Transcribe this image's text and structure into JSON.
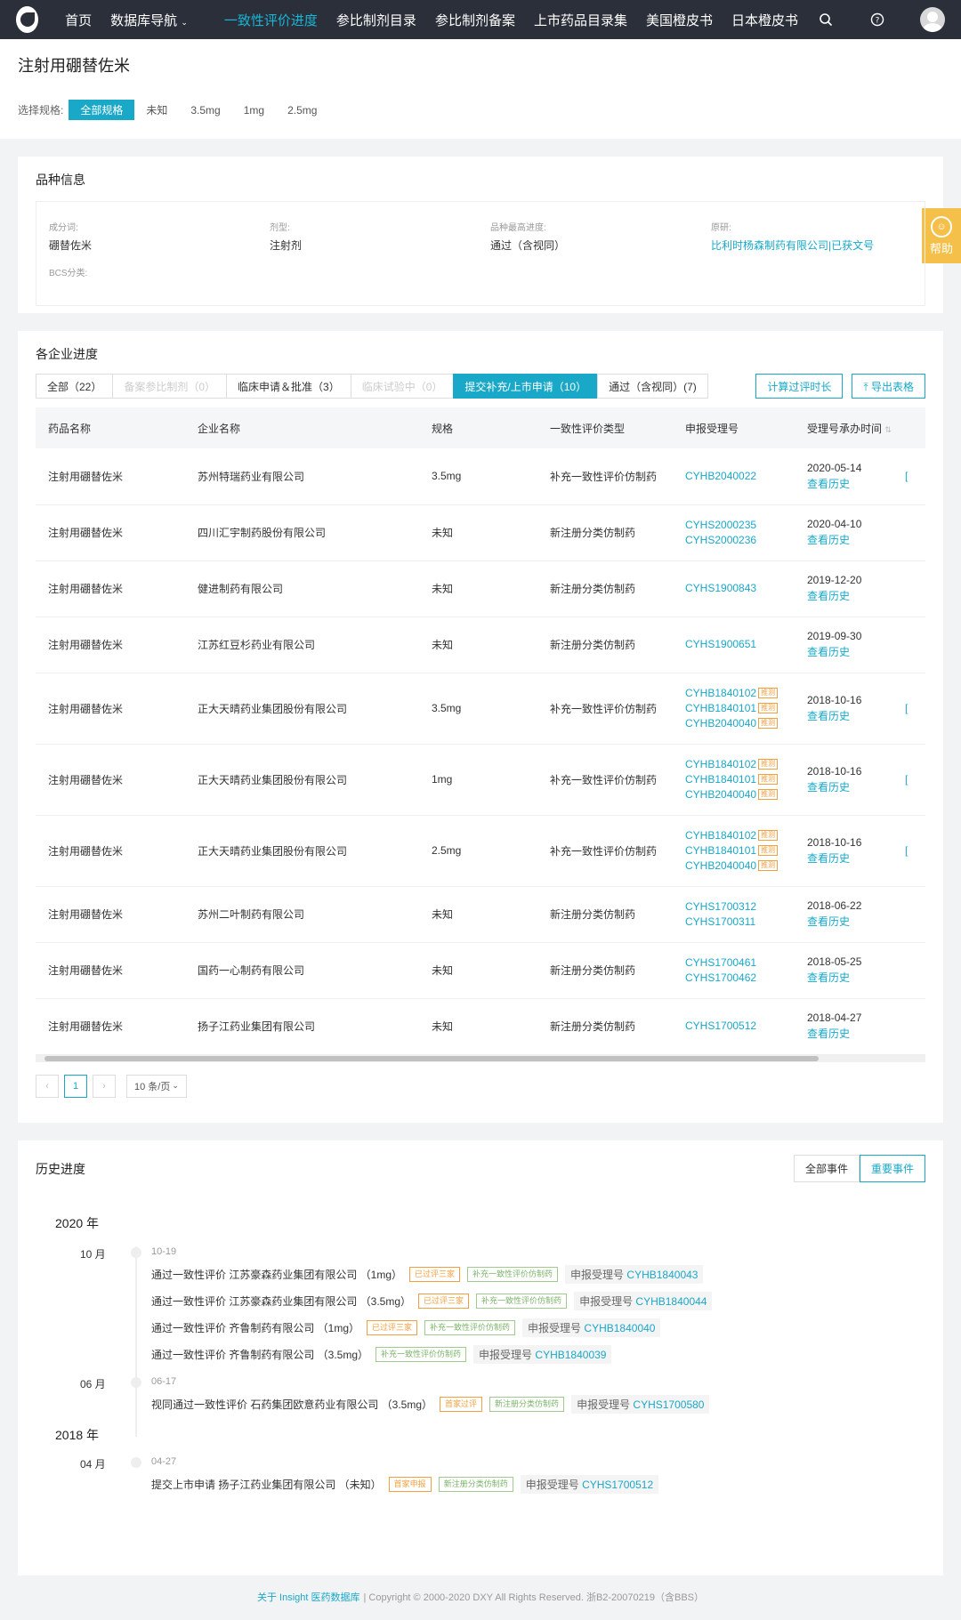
{
  "nav": {
    "items": [
      "首页",
      "数据库导航",
      "一致性评价进度",
      "参比制剂目录",
      "参比制剂备案",
      "上市药品目录集",
      "美国橙皮书",
      "日本橙皮书"
    ]
  },
  "page": {
    "title": "注射用硼替佐米",
    "spec_label": "选择规格:",
    "specs": [
      "全部规格",
      "未知",
      "3.5mg",
      "1mg",
      "2.5mg"
    ]
  },
  "info": {
    "title": "品种信息",
    "ingredient_label": "成分词:",
    "ingredient": "硼替佐米",
    "form_label": "剂型:",
    "form": "注射剂",
    "progress_label": "品种最高进度:",
    "progress": "通过（含视同）",
    "origin_label": "原研:",
    "origin": "比利时杨森制药有限公司|已获文号",
    "bcs_label": "BCS分类:"
  },
  "help": "帮助",
  "enterprise": {
    "title": "各企业进度",
    "tabs": [
      "全部（22）",
      "备案参比制剂（0）",
      "临床申请＆批准（3）",
      "临床试验中（0）",
      "提交补充/上市申请（10）",
      "通过（含视同）(7)"
    ],
    "calc_btn": "计算过评时长",
    "export_btn": "导出表格",
    "columns": [
      "药品名称",
      "企业名称",
      "规格",
      "一致性评价类型",
      "申报受理号",
      "受理号承办时间"
    ],
    "history_link": "查看历史",
    "tui": "推测",
    "rows": [
      {
        "name": "注射用硼替佐米",
        "company": "苏州特瑞药业有限公司",
        "spec": "3.5mg",
        "type": "补充一致性评价仿制药",
        "numbers": [
          "CYHB2040022"
        ],
        "date": "2020-05-14"
      },
      {
        "name": "注射用硼替佐米",
        "company": "四川汇宇制药股份有限公司",
        "spec": "未知",
        "type": "新注册分类仿制药",
        "numbers": [
          "CYHS2000235",
          "CYHS2000236"
        ],
        "date": "2020-04-10"
      },
      {
        "name": "注射用硼替佐米",
        "company": "健进制药有限公司",
        "spec": "未知",
        "type": "新注册分类仿制药",
        "numbers": [
          "CYHS1900843"
        ],
        "date": "2019-12-20"
      },
      {
        "name": "注射用硼替佐米",
        "company": "江苏红豆杉药业有限公司",
        "spec": "未知",
        "type": "新注册分类仿制药",
        "numbers": [
          "CYHS1900651"
        ],
        "date": "2019-09-30"
      },
      {
        "name": "注射用硼替佐米",
        "company": "正大天晴药业集团股份有限公司",
        "spec": "3.5mg",
        "type": "补充一致性评价仿制药",
        "numbers": [
          "CYHB1840102",
          "CYHB1840101",
          "CYHB2040040"
        ],
        "date": "2018-10-16"
      },
      {
        "name": "注射用硼替佐米",
        "company": "正大天晴药业集团股份有限公司",
        "spec": "1mg",
        "type": "补充一致性评价仿制药",
        "numbers": [
          "CYHB1840102",
          "CYHB1840101",
          "CYHB2040040"
        ],
        "date": "2018-10-16"
      },
      {
        "name": "注射用硼替佐米",
        "company": "正大天晴药业集团股份有限公司",
        "spec": "2.5mg",
        "type": "补充一致性评价仿制药",
        "numbers": [
          "CYHB1840102",
          "CYHB1840101",
          "CYHB2040040"
        ],
        "date": "2018-10-16"
      },
      {
        "name": "注射用硼替佐米",
        "company": "苏州二叶制药有限公司",
        "spec": "未知",
        "type": "新注册分类仿制药",
        "numbers": [
          "CYHS1700312",
          "CYHS1700311"
        ],
        "date": "2018-06-22"
      },
      {
        "name": "注射用硼替佐米",
        "company": "国药一心制药有限公司",
        "spec": "未知",
        "type": "新注册分类仿制药",
        "numbers": [
          "CYHS1700461",
          "CYHS1700462"
        ],
        "date": "2018-05-25"
      },
      {
        "name": "注射用硼替佐米",
        "company": "扬子江药业集团有限公司",
        "spec": "未知",
        "type": "新注册分类仿制药",
        "numbers": [
          "CYHS1700512"
        ],
        "date": "2018-04-27"
      }
    ],
    "page_current": "1",
    "page_size": "10 条/页"
  },
  "history": {
    "title": "历史进度",
    "seg_all": "全部事件",
    "seg_major": "重要事件",
    "ref_label": "申报受理号",
    "year1": "2020 年",
    "m1": "10 月",
    "d1": "10-19",
    "m2": "06 月",
    "d2": "06-17",
    "year2": "2018 年",
    "m3": "04 月",
    "d3": "04-27",
    "events": [
      {
        "text": "通过一致性评价 江苏豪森药业集团有限公司 （1mg）",
        "tags": [
          "已过评三家",
          "补充一致性评价仿制药"
        ],
        "ref": "CYHB1840043"
      },
      {
        "text": "通过一致性评价 江苏豪森药业集团有限公司 （3.5mg）",
        "tags": [
          "已过评三家",
          "补充一致性评价仿制药"
        ],
        "ref": "CYHB1840044"
      },
      {
        "text": "通过一致性评价 齐鲁制药有限公司 （1mg）",
        "tags": [
          "已过评三家",
          "补充一致性评价仿制药"
        ],
        "ref": "CYHB1840040"
      },
      {
        "text": "通过一致性评价 齐鲁制药有限公司 （3.5mg）",
        "tags": [
          "补充一致性评价仿制药"
        ],
        "ref": "CYHB1840039"
      },
      {
        "text": "视同通过一致性评价 石药集团欧意药业有限公司 （3.5mg）",
        "tags": [
          "首家过评",
          "新注册分类仿制药"
        ],
        "ref": "CYHS1700580"
      },
      {
        "text": "提交上市申请 扬子江药业集团有限公司 （未知）",
        "tags": [
          "首家申报",
          "新注册分类仿制药"
        ],
        "ref": "CYHS1700512"
      }
    ]
  },
  "footer": {
    "about": "关于 Insight 医药数据库",
    "copyright": "|  Copyright © 2000-2020 DXY All Rights Reserved. 浙B2-20070219（含BBS）"
  }
}
